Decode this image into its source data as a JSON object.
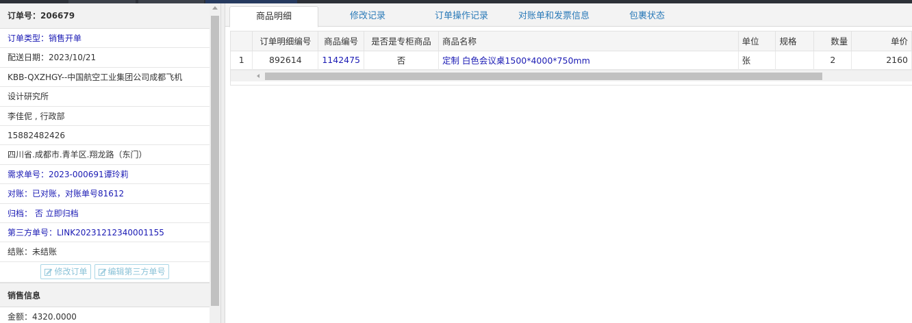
{
  "order": {
    "header": "订单号：206679",
    "rows": [
      {
        "text": "订单类型：销售开单",
        "style": "blue"
      },
      {
        "text": "配送日期：2023/10/21",
        "style": "dark"
      },
      {
        "text": "KBB-QXZHGY--中国航空工业集团公司成都飞机",
        "style": "dark"
      },
      {
        "text": "设计研究所",
        "style": "dark"
      },
      {
        "text": "李佳伲 , 行政部",
        "style": "dark"
      },
      {
        "text": "15882482426",
        "style": "dark"
      },
      {
        "text": "四川省.成都市.青羊区.翔龙路（东门）",
        "style": "dark"
      },
      {
        "text": "需求单号：2023-000691谭玲莉",
        "style": "blue"
      },
      {
        "text": "对账：已对账，对账单号81612",
        "style": "blue"
      },
      {
        "text": "归档： 否 立即归档",
        "style": "blue"
      },
      {
        "text": "第三方单号：LINK20231212340001155",
        "style": "blue"
      },
      {
        "text": "结账：未结账",
        "style": "dark"
      }
    ],
    "buttons": {
      "edit_order": "修改订单",
      "edit_third_party": "编辑第三方单号"
    },
    "sales_section": "销售信息",
    "amount": "金额：4320.0000"
  },
  "tabs": [
    {
      "label": "商品明细",
      "active": true
    },
    {
      "label": "修改记录",
      "active": false
    },
    {
      "label": "订单操作记录",
      "active": false
    },
    {
      "label": "对账单和发票信息",
      "active": false
    },
    {
      "label": "包裹状态",
      "active": false
    }
  ],
  "grid": {
    "columns": [
      "订单明细编号",
      "商品编号",
      "是否是专柜商品",
      "商品名称",
      "单位",
      "规格",
      "数量",
      "单价"
    ],
    "rows": [
      {
        "index": "1",
        "detail_no": "892614",
        "product_no": "1142475",
        "is_counter": "否",
        "name": "定制 白色会议桌1500*4000*750mm",
        "unit": "张",
        "spec": "",
        "qty": "2",
        "price": "2160"
      }
    ]
  }
}
